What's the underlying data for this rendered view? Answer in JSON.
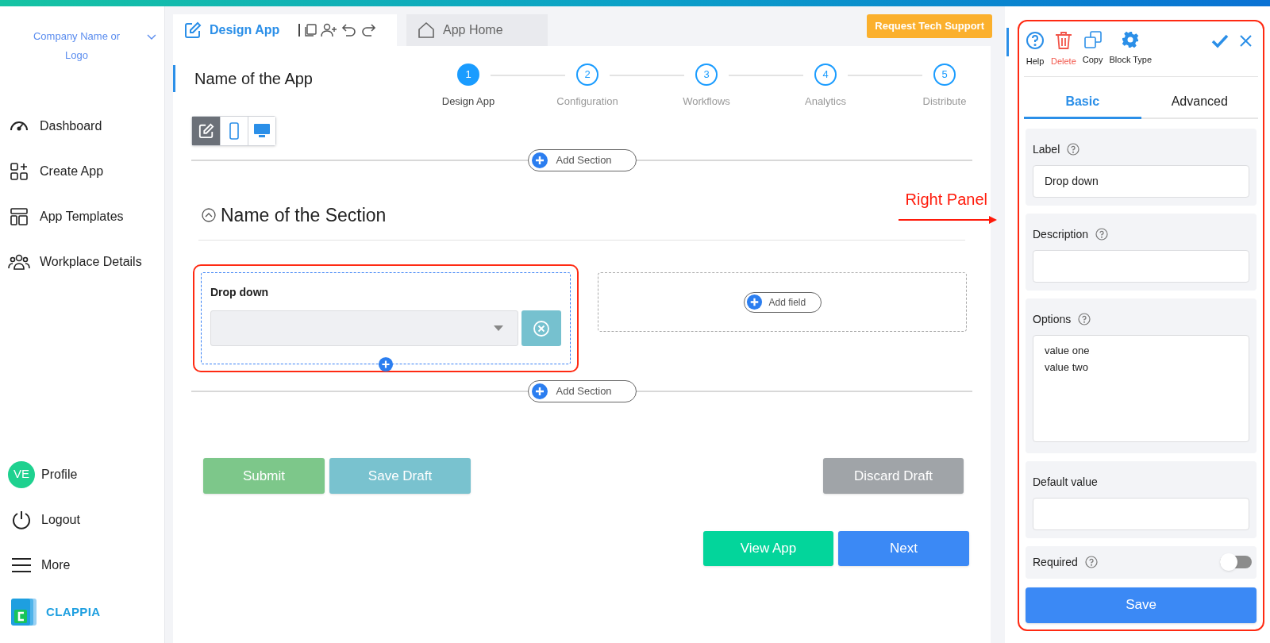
{
  "sidebar": {
    "company": "Company Name or Logo",
    "nav_items": [
      {
        "label": "Dashboard"
      },
      {
        "label": "Create App"
      },
      {
        "label": "App Templates"
      },
      {
        "label": "Workplace Details"
      }
    ],
    "bottom_items": [
      {
        "kind": "avatar",
        "initials": "VE",
        "label": "Profile"
      },
      {
        "kind": "power",
        "label": "Logout"
      },
      {
        "kind": "menu",
        "label": "More"
      }
    ],
    "brand": "CLAPPIA"
  },
  "toolbar": {
    "tabs": [
      {
        "label": "Design App",
        "selected": true
      },
      {
        "label": "App Home",
        "selected": false
      }
    ],
    "support_button": "Request Tech Support"
  },
  "app_name": "Name of the App",
  "stepper": [
    {
      "number": "1",
      "label": "Design App",
      "selected": true
    },
    {
      "number": "2",
      "label": "Configuration",
      "selected": false
    },
    {
      "number": "3",
      "label": "Workflows",
      "selected": false
    },
    {
      "number": "4",
      "label": "Analytics",
      "selected": false
    },
    {
      "number": "5",
      "label": "Distribute",
      "selected": false
    }
  ],
  "view_modes": [
    {
      "kind": "edit",
      "selected": true
    },
    {
      "kind": "mobile",
      "selected": false
    },
    {
      "kind": "desktop",
      "selected": false
    }
  ],
  "add_section_top": "Add Section",
  "section": {
    "title": "Name of the Section",
    "expanded": true,
    "fields": [
      {
        "label": "Drop down",
        "highlighted": true
      }
    ],
    "add_field": "Add field"
  },
  "add_section_bottom": "Add Section",
  "form_buttons": [
    {
      "label": "Submit",
      "kind": "submit"
    },
    {
      "label": "Save Draft",
      "kind": "draft"
    },
    {
      "label": "Discard Draft",
      "kind": "discard"
    }
  ],
  "nav_buttons": [
    {
      "label": "View App",
      "kind": "view"
    },
    {
      "label": "Next",
      "kind": "next"
    }
  ],
  "annotation": "Right Panel",
  "right_panel": {
    "actions": [
      {
        "label": "Help",
        "kind": "help"
      },
      {
        "label": "Delete",
        "kind": "delete"
      },
      {
        "label": "Copy",
        "kind": "copy"
      },
      {
        "label": "Block Type",
        "kind": "gear"
      }
    ],
    "tabs": [
      {
        "label": "Basic",
        "selected": true
      },
      {
        "label": "Advanced",
        "selected": false
      }
    ],
    "properties": [
      {
        "kind": "text",
        "label": "Label",
        "help": true,
        "value": "Drop down"
      },
      {
        "kind": "text",
        "label": "Description",
        "help": true
      },
      {
        "kind": "textarea",
        "label": "Options",
        "help": true,
        "lines": [
          "value one",
          "value two"
        ]
      },
      {
        "kind": "text",
        "label": "Default value",
        "help": false
      },
      {
        "kind": "toggle",
        "label": "Required",
        "help": true,
        "on": false
      }
    ],
    "save_button": "Save"
  }
}
